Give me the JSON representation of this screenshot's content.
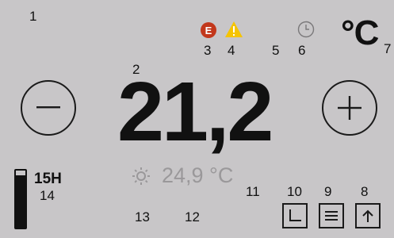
{
  "callouts": {
    "c1": "1",
    "c2": "2",
    "c3": "3",
    "c4": "4",
    "c5": "5",
    "c6": "6",
    "c7": "7",
    "c8": "8",
    "c9": "9",
    "c10": "10",
    "c11": "11",
    "c12": "12",
    "c13": "13",
    "c14": "14"
  },
  "status": {
    "error_letter": "E",
    "error_color": "#c2371b",
    "warning_icon": "warning-icon",
    "warning_color": "#f5c400",
    "clock_icon": "clock-icon"
  },
  "unit_label": "°C",
  "setpoint": "21,2",
  "controls": {
    "decrease_icon": "minus-icon",
    "increase_icon": "plus-icon"
  },
  "actual_temperature": {
    "value": "24,9 °C",
    "icon": "sun-icon"
  },
  "timer": {
    "label": "15H",
    "level": 0.92
  },
  "buttons": {
    "schedule_icon": "schedule-icon",
    "menu_icon": "menu-icon",
    "up_icon": "arrow-up-icon"
  },
  "colors": {
    "background": "#c8c6c8",
    "foreground": "#111111",
    "muted": "#9a989a"
  }
}
